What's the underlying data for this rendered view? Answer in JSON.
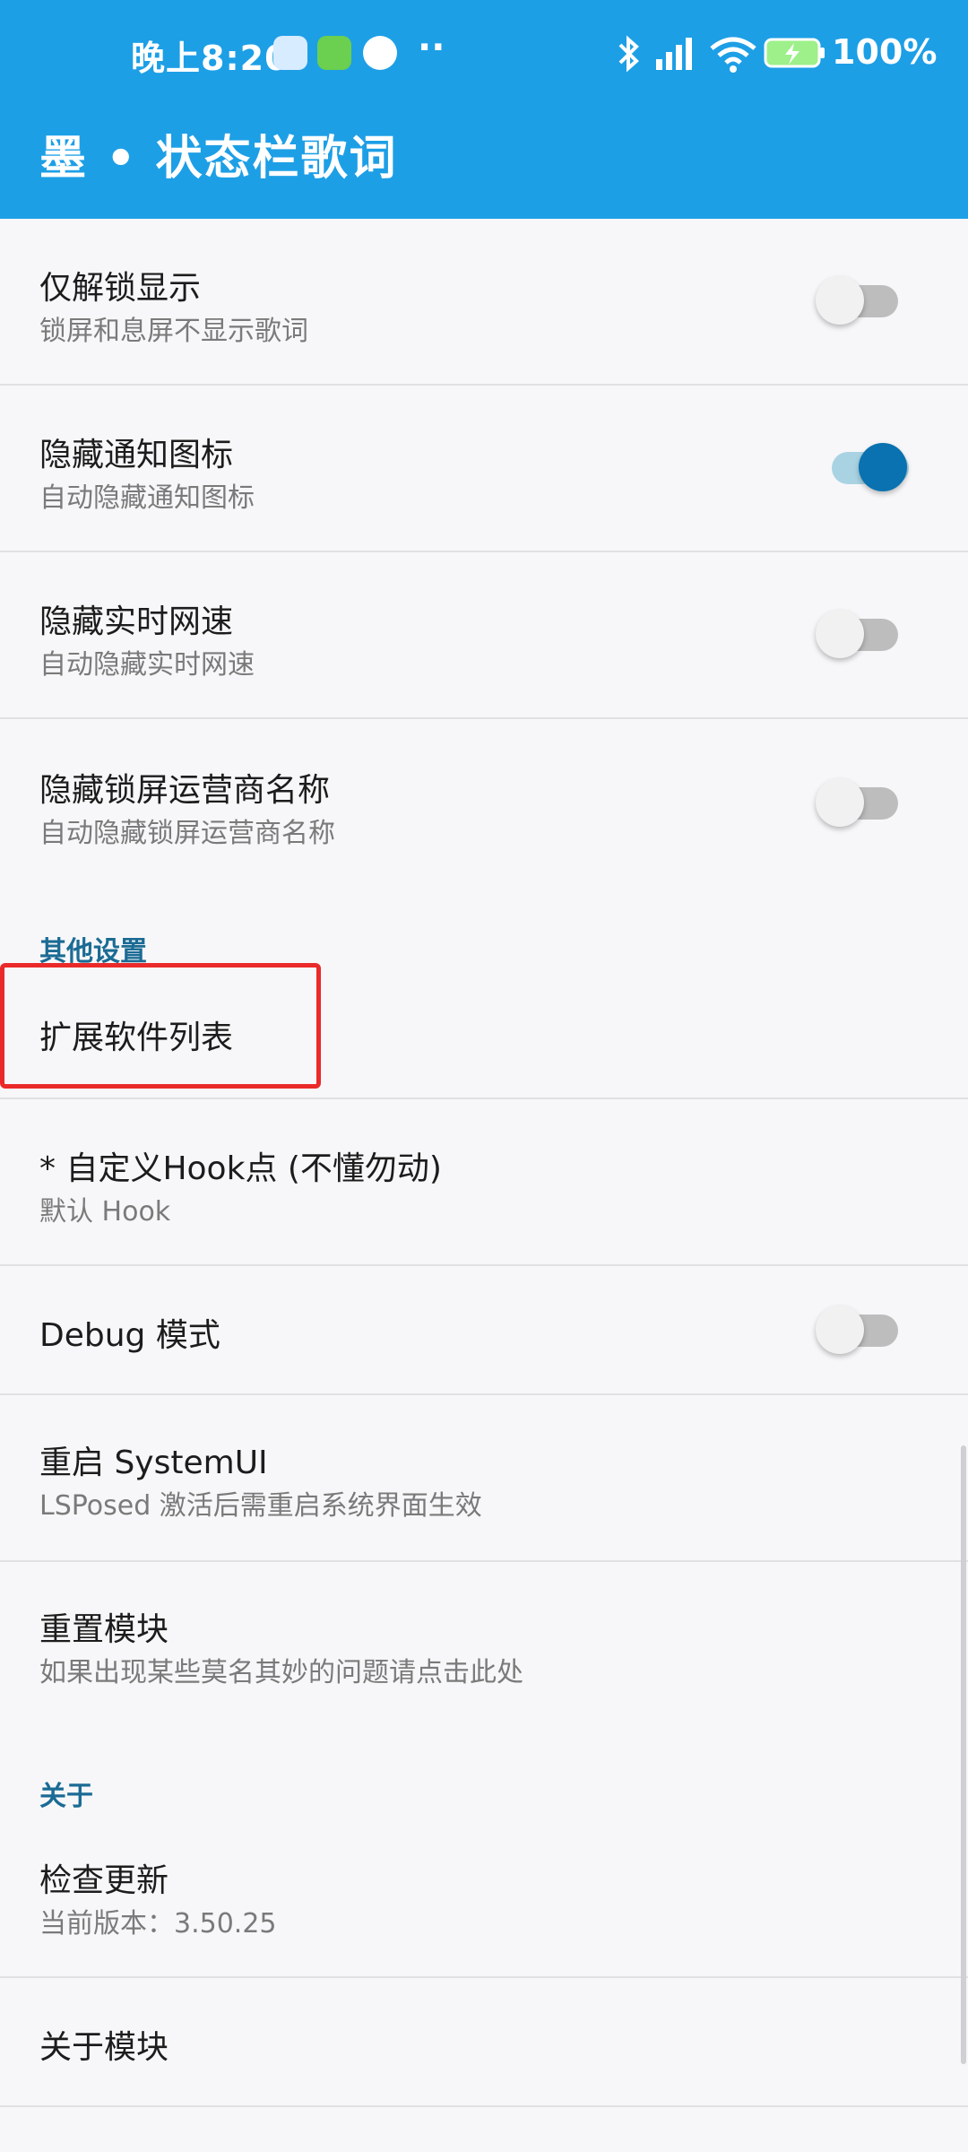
{
  "status_bar": {
    "time": "晚上8:20",
    "dots": "··",
    "battery_pct": "100%"
  },
  "app": {
    "title": "墨 • 状态栏歌词",
    "accent_color": "#1d9fe6",
    "section_color": "#1b6b94"
  },
  "items": [
    {
      "title": "仅解锁显示",
      "subtitle": "锁屏和息屏不显示歌词",
      "switch": false
    },
    {
      "title": "隐藏通知图标",
      "subtitle": "自动隐藏通知图标",
      "switch": true
    },
    {
      "title": "隐藏实时网速",
      "subtitle": "自动隐藏实时网速",
      "switch": false
    },
    {
      "title": "隐藏锁屏运营商名称",
      "subtitle": "自动隐藏锁屏运营商名称",
      "switch": false
    }
  ],
  "sections": {
    "other": "其他设置",
    "about": "关于"
  },
  "other_items": {
    "extension_list": "扩展软件列表",
    "custom_hook_title": "* 自定义Hook点 (不懂勿动)",
    "custom_hook_sub": "默认 Hook",
    "debug_title": "Debug 模式",
    "debug_switch": false,
    "restart_title": "重启 SystemUI",
    "restart_sub": "LSPosed 激活后需重启系统界面生效",
    "reset_title": "重置模块",
    "reset_sub": "如果出现某些莫名其妙的问题请点击此处"
  },
  "about_items": {
    "check_update_title": "检查更新",
    "check_update_sub": "当前版本：3.50.25",
    "about_module": "关于模块"
  }
}
